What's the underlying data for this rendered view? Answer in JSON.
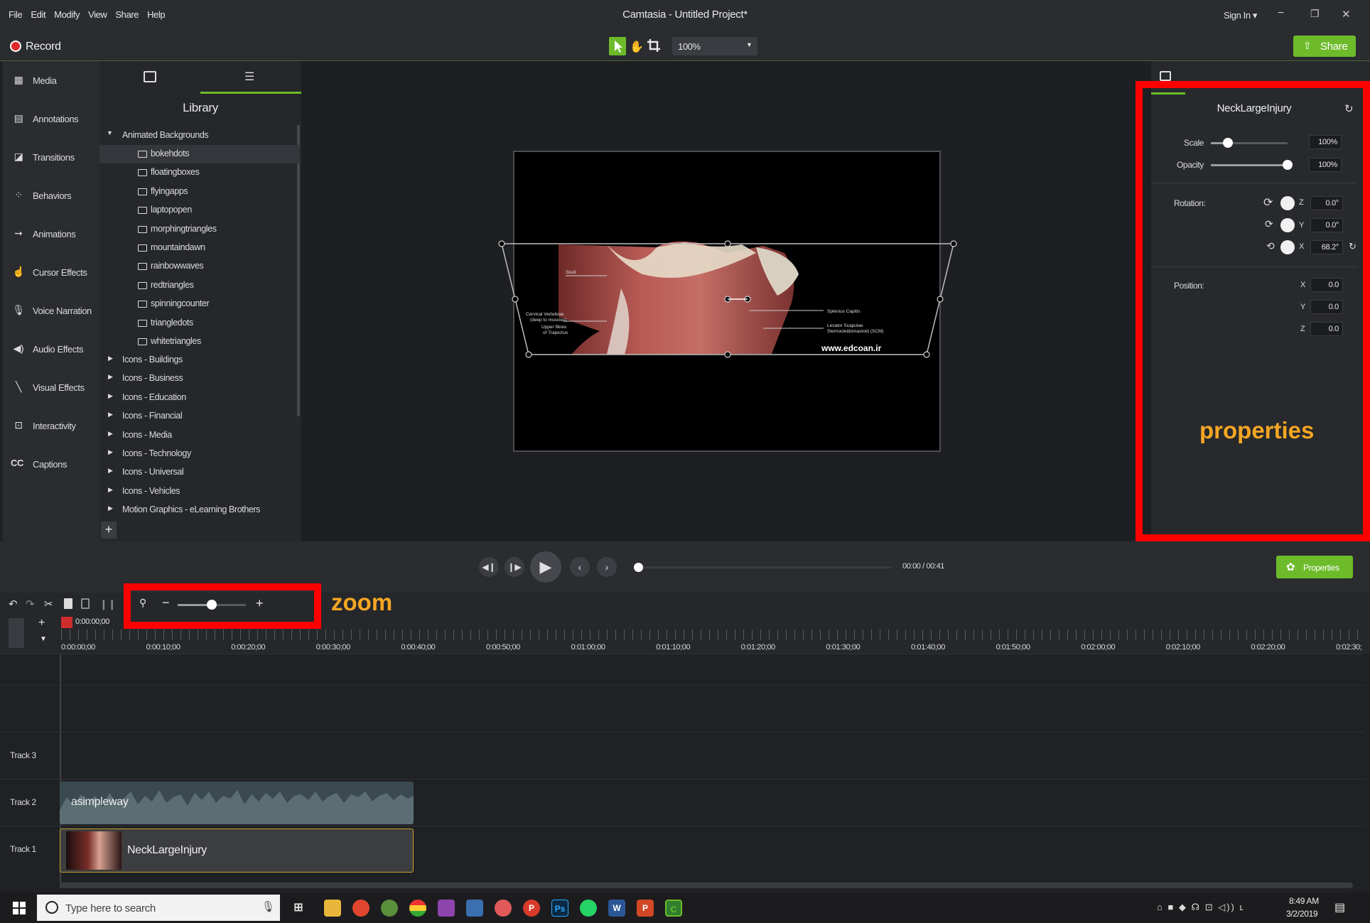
{
  "menu": [
    "File",
    "Edit",
    "Modify",
    "View",
    "Share",
    "Help"
  ],
  "window": {
    "title": "Camtasia - Untitled Project*",
    "sign_in": "Sign In ▾",
    "minimize": "−",
    "maximize": "❐",
    "close": "✕"
  },
  "recordbar": {
    "record_label": "Record",
    "zoom_value": "100%",
    "share_label": "Share"
  },
  "tools": [
    {
      "icon": "media-icon",
      "glyph": "▦",
      "label": "Media"
    },
    {
      "icon": "annotations-icon",
      "glyph": "▤",
      "label": "Annotations"
    },
    {
      "icon": "transitions-icon",
      "glyph": "◪",
      "label": "Transitions"
    },
    {
      "icon": "behaviors-icon",
      "glyph": "⁘",
      "label": "Behaviors"
    },
    {
      "icon": "animations-icon",
      "glyph": "➙",
      "label": "Animations"
    },
    {
      "icon": "cursor-effects-icon",
      "glyph": "☝",
      "label": "Cursor Effects"
    },
    {
      "icon": "microphone-icon",
      "glyph": "🎙",
      "label": "Voice Narration"
    },
    {
      "icon": "speaker-icon",
      "glyph": "◀)",
      "label": "Audio Effects"
    },
    {
      "icon": "magic-wand-icon",
      "glyph": "╲",
      "label": "Visual Effects"
    },
    {
      "icon": "interactivity-icon",
      "glyph": "⊡",
      "label": "Interactivity"
    },
    {
      "icon": "captions-icon",
      "glyph": "CC",
      "label": "Captions"
    }
  ],
  "library": {
    "title": "Library",
    "open_folder": "Animated Backgrounds",
    "items": [
      "bokehdots",
      "floatingboxes",
      "flyingapps",
      "laptopopen",
      "morphingtriangles",
      "mountaindawn",
      "rainbowwaves",
      "redtriangles",
      "spinningcounter",
      "triangledots",
      "whitetriangles"
    ],
    "folders": [
      "Icons - Buildings",
      "Icons - Business",
      "Icons - Education",
      "Icons - Financial",
      "Icons - Media",
      "Icons - Technology",
      "Icons - Universal",
      "Icons - Vehicles",
      "Motion Graphics - eLearning Brothers"
    ],
    "add_label": "+"
  },
  "canvas": {
    "labels_left": [
      "Skull",
      "Cervical Vertebrae",
      "(deep to muscles)",
      "Upper fibres",
      "of Trapezius"
    ],
    "labels_right": [
      "Splenius Capitis",
      "Levator Scapulae",
      "Sternocleidomastoid (SCM)"
    ],
    "watermark": "www.edcoan.ir"
  },
  "properties": {
    "clip_name": "NeckLargeInjury",
    "scale_label": "Scale",
    "scale_value": "100%",
    "scale_level": 0.22,
    "opacity_label": "Opacity",
    "opacity_value": "100%",
    "opacity_level": 1.0,
    "rotation_label": "Rotation:",
    "rot_z_axis": "Z",
    "rot_z": "0.0°",
    "rot_y_axis": "Y",
    "rot_y": "0.0°",
    "rot_x_axis": "X",
    "rot_x": "68.2°",
    "position_label": "Position:",
    "pos_x_axis": "X",
    "pos_x": "0.0",
    "pos_y_axis": "Y",
    "pos_y": "0.0",
    "pos_z_axis": "Z",
    "pos_z": "0.0",
    "properties_button": "Properties"
  },
  "playback": {
    "time": "00:00 / 00:41",
    "progress": 0.0
  },
  "timeline": {
    "playhead": "0:00:00;00",
    "ticks": [
      "0:00:00;00",
      "0:00:10;00",
      "0:00:20;00",
      "0:00:30;00",
      "0:00:40;00",
      "0:00:50;00",
      "0:01:00;00",
      "0:01:10;00",
      "0:01:20;00",
      "0:01:30;00",
      "0:01:40;00",
      "0:01:50;00",
      "0:02:00;00",
      "0:02:10;00",
      "0:02:20;00",
      "0:02:30;"
    ],
    "zoom_level": 0.5,
    "tracks": [
      {
        "name": "Track 3",
        "clip": ""
      },
      {
        "name": "Track 2",
        "clip": "asimpleway"
      },
      {
        "name": "Track 1",
        "clip": "NeckLargeInjury"
      }
    ]
  },
  "annotations": {
    "properties": "properties",
    "zoom": "zoom"
  },
  "taskbar": {
    "search_placeholder": "Type here to search",
    "time": "8:49 AM",
    "date": "3/2/2019"
  },
  "colors": {
    "accent_green": "#6dbb2a",
    "annotation_red": "#ff0000",
    "annotation_text": "#f5a623"
  }
}
